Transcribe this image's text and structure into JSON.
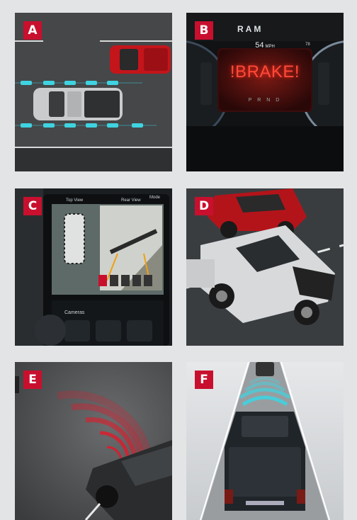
{
  "panels": [
    {
      "label": "A",
      "scene": "lane keep assist overhead view with two pickup trucks"
    },
    {
      "label": "B",
      "scene": "instrument cluster showing brake warning"
    },
    {
      "label": "C",
      "scene": "touchscreen surround view camera display"
    },
    {
      "label": "D",
      "scene": "two pickup trucks driving on road"
    },
    {
      "label": "E",
      "scene": "truck with radar sensor waves"
    },
    {
      "label": "F",
      "scene": "truck following vehicle with adaptive cruise sensor beams"
    }
  ],
  "cluster": {
    "logo": "RAM",
    "speed": "54",
    "speed_unit": "MPH",
    "warning": "!BRAKE!",
    "gears": "P R N D",
    "temp": "78"
  },
  "screen": {
    "top_view": "Top View",
    "rear_view": "Rear View",
    "mode": "Mode",
    "cameras": "Cameras"
  },
  "colors": {
    "badge": "#c8102e",
    "lane_cyan": "#3fd3e0",
    "radar_red": "#e01a2a"
  }
}
